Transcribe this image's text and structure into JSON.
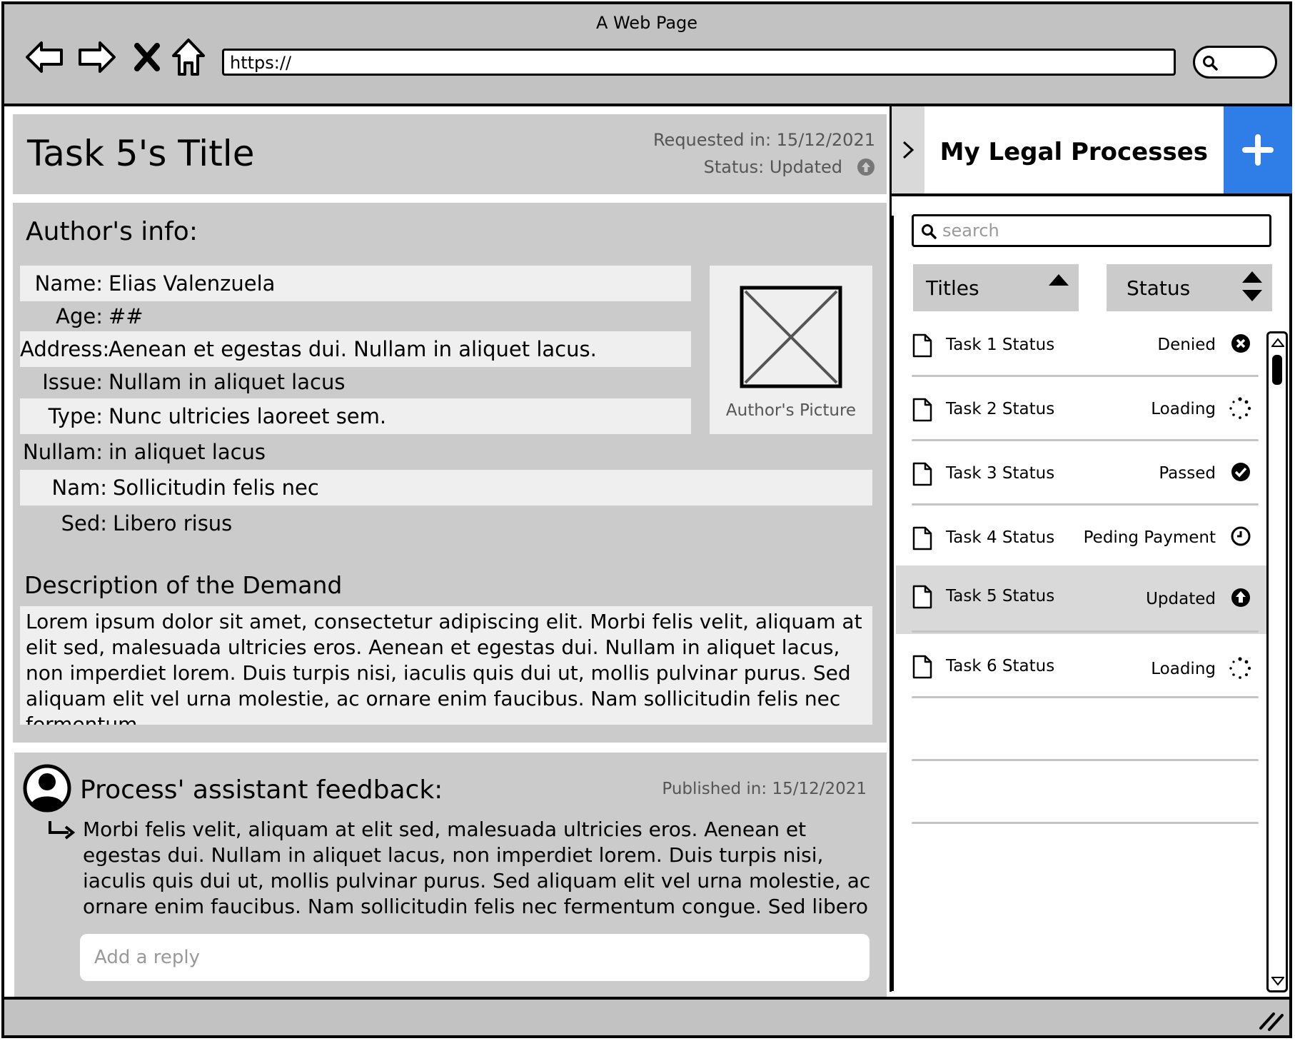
{
  "window": {
    "title": "A Web Page",
    "url": "https://"
  },
  "header": {
    "task_title": "Task 5's Title",
    "requested": "Requested in: 15/12/2021",
    "status": "Status: Updated"
  },
  "author": {
    "heading": "Author's info:",
    "fields": [
      {
        "label": "Name:",
        "value": "Elias Valenzuela"
      },
      {
        "label": "Age:",
        "value": "##"
      },
      {
        "label": "Address:",
        "value": "Aenean et egestas dui. Nullam in aliquet lacus."
      },
      {
        "label": "Issue:",
        "value": "Nullam in aliquet lacus"
      },
      {
        "label": "Type:",
        "value": "Nunc ultricies laoreet sem."
      },
      {
        "label": "Nullam:",
        "value": "in aliquet lacus"
      },
      {
        "label": "Nam:",
        "value": "Sollicitudin felis nec"
      },
      {
        "label": "Sed:",
        "value": "Libero risus"
      }
    ],
    "picture_label": "Author's Picture"
  },
  "description": {
    "heading": "Description of the Demand",
    "text": "Lorem ipsum dolor sit amet, consectetur adipiscing elit. Morbi felis velit, aliquam at elit sed, malesuada ultricies eros. Aenean et egestas dui. Nullam in aliquet lacus, non imperdiet lorem. Duis turpis nisi, iaculis quis dui ut, mollis pulvinar purus. Sed aliquam elit vel urna molestie, ac ornare enim faucibus. Nam sollicitudin felis nec fermentum"
  },
  "feedback": {
    "title": "Process' assistant feedback:",
    "published": "Published in: 15/12/2021",
    "text": "Morbi felis velit, aliquam at elit sed, malesuada ultricies eros. Aenean et egestas dui. Nullam in aliquet lacus, non imperdiet lorem. Duis turpis nisi, iaculis quis dui ut, mollis pulvinar purus. Sed aliquam elit vel urna molestie, ac ornare enim faucibus. Nam sollicitudin felis nec fermentum congue. Sed libero risus, aliquam",
    "reply_placeholder": "Add a reply"
  },
  "sidebar": {
    "title": "My Legal Processes",
    "search_placeholder": "search",
    "sort_titles": "Titles",
    "sort_status": "Status",
    "tasks": [
      {
        "name": "Task 1 Status",
        "status": "Denied",
        "icon": "denied-icon"
      },
      {
        "name": "Task 2 Status",
        "status": "Loading",
        "icon": "loading-icon"
      },
      {
        "name": "Task 3 Status",
        "status": "Passed",
        "icon": "passed-icon"
      },
      {
        "name": "Task 4 Status",
        "status": "Peding Payment",
        "icon": "clock-icon"
      },
      {
        "name": "Task 5 Status",
        "status": "Updated",
        "icon": "updated-icon"
      },
      {
        "name": "Task 6 Status",
        "status": "Loading",
        "icon": "loading-icon"
      }
    ],
    "active_index": 4
  },
  "colors": {
    "accent": "#2f7de6",
    "panel": "#cbcbcb",
    "row_shade": "#efefef",
    "chrome": "#c2c2c2"
  }
}
